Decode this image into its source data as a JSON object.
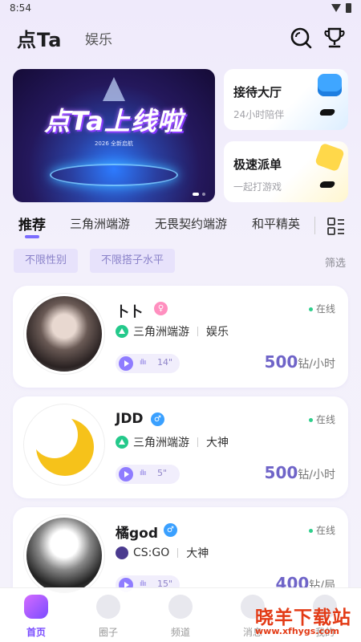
{
  "status_bar": {
    "time": "8:54"
  },
  "header": {
    "logo": "点Ta",
    "subtab": "娱乐"
  },
  "banner": {
    "headline": "点Ta上线啦",
    "subline": "2026 全新启航"
  },
  "side_cards": [
    {
      "title": "接待大厅",
      "subtitle": "24小时陪伴"
    },
    {
      "title": "极速派单",
      "subtitle": "一起打游戏"
    }
  ],
  "tabs": [
    "推荐",
    "三角洲端游",
    "无畏契约端游",
    "和平精英"
  ],
  "filters": {
    "chips": [
      "不限性别",
      "不限搭子水平"
    ],
    "filter_label": "筛选"
  },
  "players": [
    {
      "name": "卜卜",
      "gender_symbol": "♀",
      "status": "在线",
      "game": "三角洲端游",
      "tag": "娱乐",
      "voice_seconds": "14\"",
      "price": "500",
      "unit": "钻/小时"
    },
    {
      "name": "JDD",
      "gender_symbol": "♂",
      "status": "在线",
      "game": "三角洲端游",
      "tag": "大神",
      "voice_seconds": "5\"",
      "price": "500",
      "unit": "钻/小时"
    },
    {
      "name": "橘god",
      "gender_symbol": "♂",
      "status": "在线",
      "game": "CS:GO",
      "tag": "大神",
      "voice_seconds": "15\"",
      "price": "400",
      "unit": "钻/局"
    }
  ],
  "bottom_nav": [
    {
      "label": "首页",
      "active": true
    },
    {
      "label": "圈子",
      "active": false
    },
    {
      "label": "频道",
      "active": false
    },
    {
      "label": "消息",
      "active": false
    },
    {
      "label": "我的",
      "active": false
    }
  ],
  "watermark": {
    "line1": "晓羊下载站",
    "line2": "www.xfhygs.com"
  }
}
